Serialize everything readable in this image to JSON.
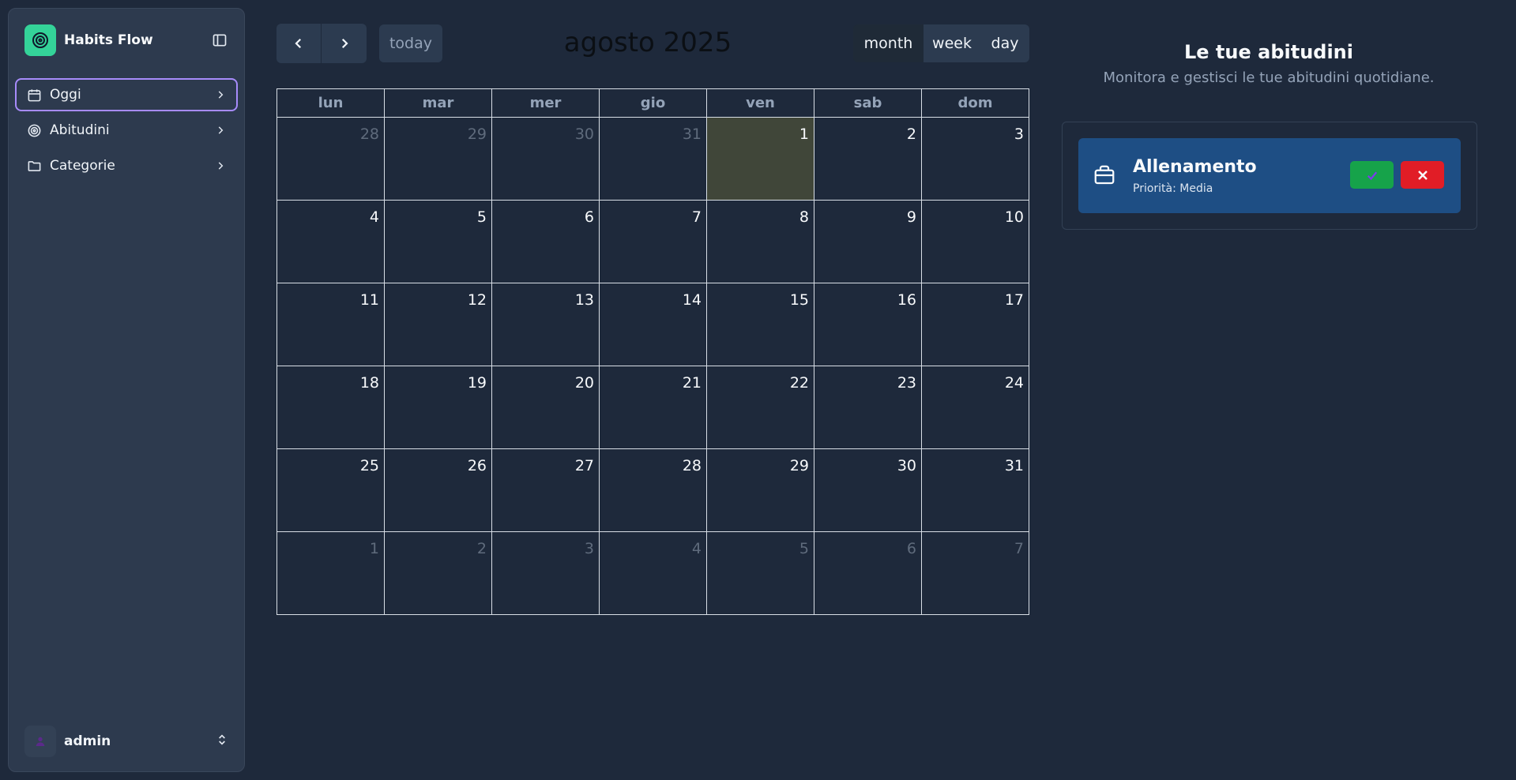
{
  "app": {
    "name": "Habits Flow"
  },
  "sidebar": {
    "items": [
      {
        "label": "Oggi",
        "icon": "calendar-icon",
        "active": true
      },
      {
        "label": "Abitudini",
        "icon": "target-icon",
        "active": false
      },
      {
        "label": "Categorie",
        "icon": "folder-icon",
        "active": false
      }
    ],
    "user": {
      "name": "admin"
    }
  },
  "calendar": {
    "title": "agosto 2025",
    "today_label": "today",
    "views": [
      "month",
      "week",
      "day"
    ],
    "active_view": "month",
    "weekdays": [
      "lun",
      "mar",
      "mer",
      "gio",
      "ven",
      "sab",
      "dom"
    ],
    "weeks": [
      [
        {
          "d": "28",
          "o": true
        },
        {
          "d": "29",
          "o": true
        },
        {
          "d": "30",
          "o": true
        },
        {
          "d": "31",
          "o": true
        },
        {
          "d": "1",
          "t": true
        },
        {
          "d": "2"
        },
        {
          "d": "3"
        }
      ],
      [
        {
          "d": "4"
        },
        {
          "d": "5"
        },
        {
          "d": "6"
        },
        {
          "d": "7"
        },
        {
          "d": "8"
        },
        {
          "d": "9"
        },
        {
          "d": "10"
        }
      ],
      [
        {
          "d": "11"
        },
        {
          "d": "12"
        },
        {
          "d": "13"
        },
        {
          "d": "14"
        },
        {
          "d": "15"
        },
        {
          "d": "16"
        },
        {
          "d": "17"
        }
      ],
      [
        {
          "d": "18"
        },
        {
          "d": "19"
        },
        {
          "d": "20"
        },
        {
          "d": "21"
        },
        {
          "d": "22"
        },
        {
          "d": "23"
        },
        {
          "d": "24"
        }
      ],
      [
        {
          "d": "25"
        },
        {
          "d": "26"
        },
        {
          "d": "27"
        },
        {
          "d": "28"
        },
        {
          "d": "29"
        },
        {
          "d": "30"
        },
        {
          "d": "31"
        }
      ],
      [
        {
          "d": "1",
          "o": true
        },
        {
          "d": "2",
          "o": true
        },
        {
          "d": "3",
          "o": true
        },
        {
          "d": "4",
          "o": true
        },
        {
          "d": "5",
          "o": true
        },
        {
          "d": "6",
          "o": true
        },
        {
          "d": "7",
          "o": true
        }
      ]
    ]
  },
  "panel": {
    "title": "Le tue abitudini",
    "subtitle": "Monitora e gestisci le tue abitudini quotidiane.",
    "habits": [
      {
        "name": "Allenamento",
        "priority": "Priorità: Media",
        "icon": "briefcase-icon"
      }
    ]
  },
  "colors": {
    "accent": "#34d399",
    "active_border": "#a78bfa",
    "habit_card": "#1e4e84",
    "done": "#16a34a",
    "skip": "#e11d26",
    "today_cell": "#404639"
  }
}
